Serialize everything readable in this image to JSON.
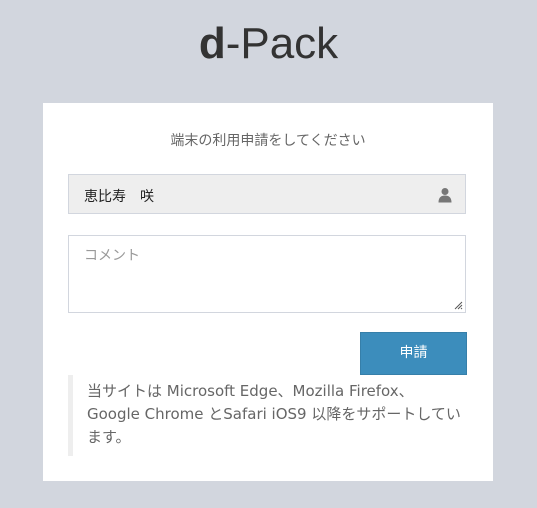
{
  "logo": {
    "bold": "d",
    "rest": "-Pack"
  },
  "form": {
    "title": "端末の利用申請をしてください",
    "name_value": "恵比寿　咲",
    "comment_placeholder": "コメント",
    "submit_label": "申請",
    "user_icon": "user-icon"
  },
  "notice": {
    "text": "当サイトは Microsoft Edge、Mozilla Firefox、Google Chrome とSafari iOS9 以降をサポートしています。"
  },
  "colors": {
    "background": "#d2d6de",
    "panel": "#ffffff",
    "button": "#3c8dbc",
    "field_fill": "#eeeeee"
  }
}
